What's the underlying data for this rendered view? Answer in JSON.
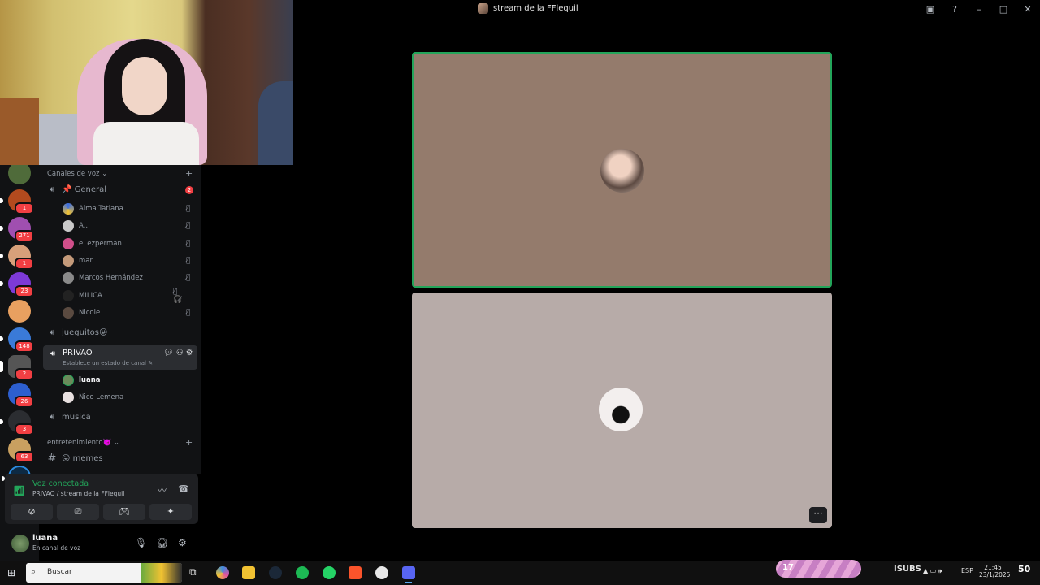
{
  "window": {
    "title": "stream de la FFlequil",
    "title_icons": [
      "screen-share-icon",
      "help-icon",
      "minimize-icon",
      "maximize-icon",
      "close-icon"
    ]
  },
  "servers": [
    {
      "badge": ""
    },
    {
      "badge": "1"
    },
    {
      "badge": "271"
    },
    {
      "badge": "1"
    },
    {
      "badge": "23"
    },
    {
      "badge": ""
    },
    {
      "badge": "148"
    },
    {
      "badge": "2"
    },
    {
      "badge": "26"
    },
    {
      "badge": "3"
    },
    {
      "badge": "63"
    },
    {
      "badge": ""
    }
  ],
  "channels": {
    "voice_category": "Canales de voz",
    "general": {
      "name": "📌 General",
      "count": "2"
    },
    "general_members": [
      {
        "name": "Alma Tatiana"
      },
      {
        "name": "A..."
      },
      {
        "name": "el ezperman"
      },
      {
        "name": "mar"
      },
      {
        "name": "Marcos Hernández"
      },
      {
        "name": "MILICA"
      },
      {
        "name": "Nicole"
      }
    ],
    "jueguitos": "jueguitos😛",
    "privao": {
      "name": "PRIVAO",
      "status": "Establece un estado de canal ✎"
    },
    "privao_members": [
      {
        "name": "luana"
      },
      {
        "name": "Nico Lemena"
      }
    ],
    "musica": "musica",
    "ent_category": "entretenimiento👿",
    "memes": "😛 memes"
  },
  "voice": {
    "title": "Voz conectada",
    "subtitle": "PRIVAO / stream de la FFlequil"
  },
  "user": {
    "name": "luana",
    "status": "En canal de voz"
  },
  "taskbar": {
    "search_placeholder": "Buscar",
    "pink_counter": "17",
    "lang": "ESP",
    "time": "21:45",
    "date": "23/1/2025",
    "notifications": "50"
  },
  "colors": {
    "accent_green": "#23a55a",
    "badge_red": "#f23f43",
    "tile1_bg": "#947b6c",
    "tile2_bg": "#b7aba8"
  }
}
